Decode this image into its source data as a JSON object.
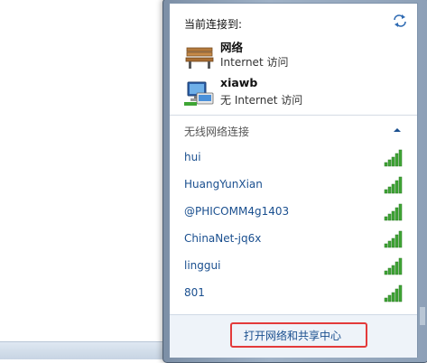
{
  "header": {
    "connected_label": "当前连接到:",
    "refresh_icon": "refresh-arrows-icon"
  },
  "connections": [
    {
      "name": "网络",
      "status": "Internet 访问",
      "icon": "bench-network-icon"
    },
    {
      "name": "xiawb",
      "status": "无 Internet 访问",
      "icon": "network-computer-icon"
    }
  ],
  "wireless": {
    "section_title": "无线网络连接",
    "collapse_icon": "chevron-up-icon",
    "networks": [
      {
        "ssid": "hui",
        "signal": 5
      },
      {
        "ssid": "HuangYunXian",
        "signal": 5
      },
      {
        "ssid": "@PHICOMM4g1403",
        "signal": 5
      },
      {
        "ssid": "ChinaNet-jq6x",
        "signal": 5
      },
      {
        "ssid": "linggui",
        "signal": 5
      },
      {
        "ssid": "801",
        "signal": 5
      }
    ]
  },
  "footer": {
    "open_center_label": "打开网络和共享中心"
  },
  "colors": {
    "link": "#1a4f8f",
    "signal_green": "#3fa535",
    "highlight": "#e33a3a"
  }
}
